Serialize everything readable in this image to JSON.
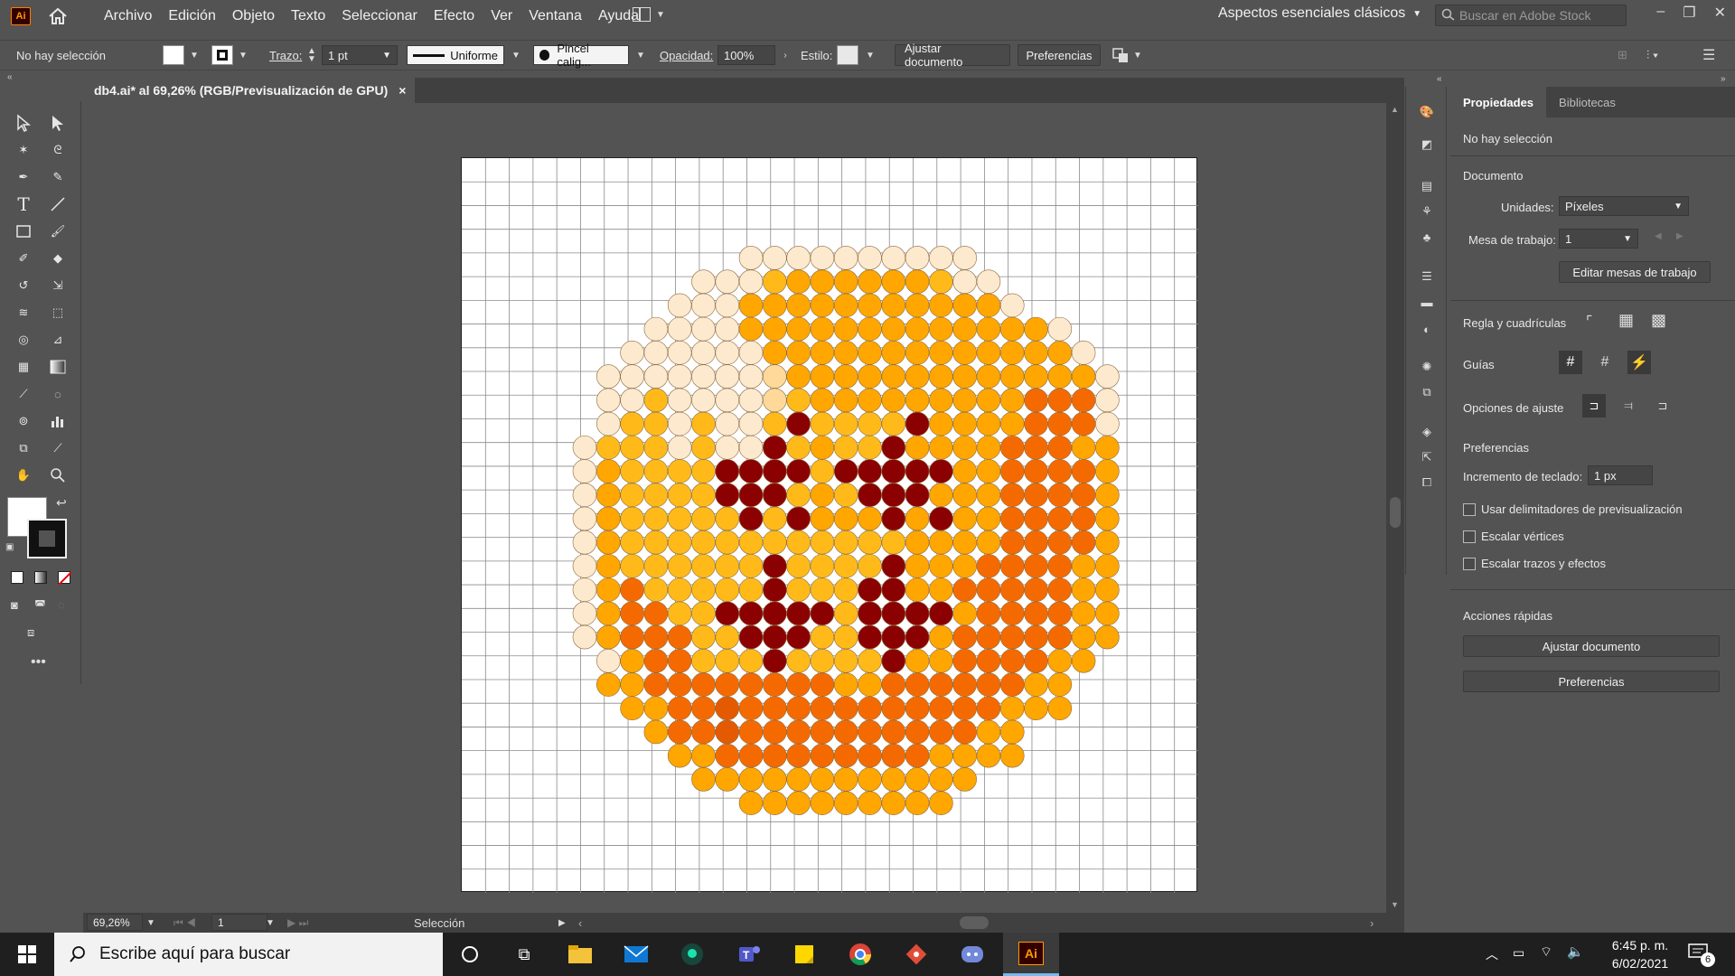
{
  "menubar": {
    "app_logo": "Ai",
    "items": [
      "Archivo",
      "Edición",
      "Objeto",
      "Texto",
      "Seleccionar",
      "Efecto",
      "Ver",
      "Ventana",
      "Ayuda"
    ],
    "workspace": "Aspectos esenciales clásicos",
    "search_placeholder": "Buscar en Adobe Stock"
  },
  "controlbar": {
    "selection": "No hay selección",
    "stroke_label": "Trazo:",
    "stroke_value": "1 pt",
    "stroke_profile": "Uniforme",
    "brush": "Pincel calig...",
    "opacity_label": "Opacidad:",
    "opacity_value": "100%",
    "style_label": "Estilo:",
    "fit_button": "Ajustar documento",
    "prefs_button": "Preferencias"
  },
  "document": {
    "tab_title": "db4.ai* al 69,26% (RGB/Previsualización de GPU)",
    "close": "×"
  },
  "statusbar": {
    "zoom": "69,26%",
    "artboard": "1",
    "tool": "Selección"
  },
  "properties": {
    "tabs": [
      "Propiedades",
      "Bibliotecas"
    ],
    "no_selection": "No hay selección",
    "document_heading": "Documento",
    "units_label": "Unidades:",
    "units_value": "Píxeles",
    "artboard_label": "Mesa de trabajo:",
    "artboard_value": "1",
    "edit_artboards": "Editar mesas de trabajo",
    "rulers_label": "Regla y cuadrículas",
    "guides_label": "Guías",
    "snap_label": "Opciones de ajuste",
    "prefs_heading": "Preferencias",
    "keyboard_inc_label": "Incremento de teclado:",
    "keyboard_inc_value": "1 px",
    "checkboxes": [
      "Usar delimitadores de previsualización",
      "Escalar vértices",
      "Escalar trazos y efectos"
    ],
    "quick_actions": "Acciones rápidas",
    "fit_doc_button": "Ajustar documento",
    "prefs_button": "Preferencias"
  },
  "taskbar": {
    "search_placeholder": "Escribe aquí para buscar",
    "time": "6:45 p. m.",
    "date": "6/02/2021",
    "notifications": "6",
    "illustrator_label": "Ai"
  },
  "artwork": {
    "palette": {
      "W": "#ffffff",
      "L": "#fde9cd",
      "M": "#ffd99a",
      "Y": "#ffba1a",
      "O": "#ffa600",
      "D": "#ff8c00",
      "R": "#f56a00",
      "B": "#e45a00",
      "X": "#8b0000"
    },
    "rows": [
      "..........LLLLLLLLLL..........",
      "........LLLYOOOOOOYLL.........",
      ".......LLLOOOOOOOOOOOL........",
      "......LLLLOOOOOOOOOOOOOL......",
      ".....LLLLLLOOOOOOOOOOOOOL.....",
      "....LLLLLLLMOOOOOOOOOOOOOL....",
      "....LLYLLLLMYOOOOOOOOORRRL....",
      "....LYYLYLLYXYYYYXOOOORRRL....",
      "...LYYYLYLLXYOYYXOOOORRROO....",
      "...LOYYYYXXXXYXXXXXOORRRRO....",
      "...LOYYYYXXXYOYXXXOOORRRRO....",
      "...LOYYYYYXYXOOOXOXOORRRRO....",
      "...LOYYYYYYYYYYYYOOOORRRRO....",
      "...LOYYYYYYXYYYYXOOORRRROO....",
      "...LORYYYYYXYYYXXOORRRRROO....",
      "...LORRYYXXXXXYXXXXORRRROO....",
      "...LORRRYYXXXYYXXXORRRRROO....",
      "....LORRYYYXYYYYXOORRRROO.....",
      "....OORRRRRRRROORRRRRROO......",
      ".....OORRBRRRRRRRRRRROOO......",
      "......ORRBRRRRRRRRRROO........",
      ".......OORRRRRRRRROOOO........",
      "........OOOOOOOOOOOO..........",
      "..........OOOOOOOOO..........."
    ]
  }
}
